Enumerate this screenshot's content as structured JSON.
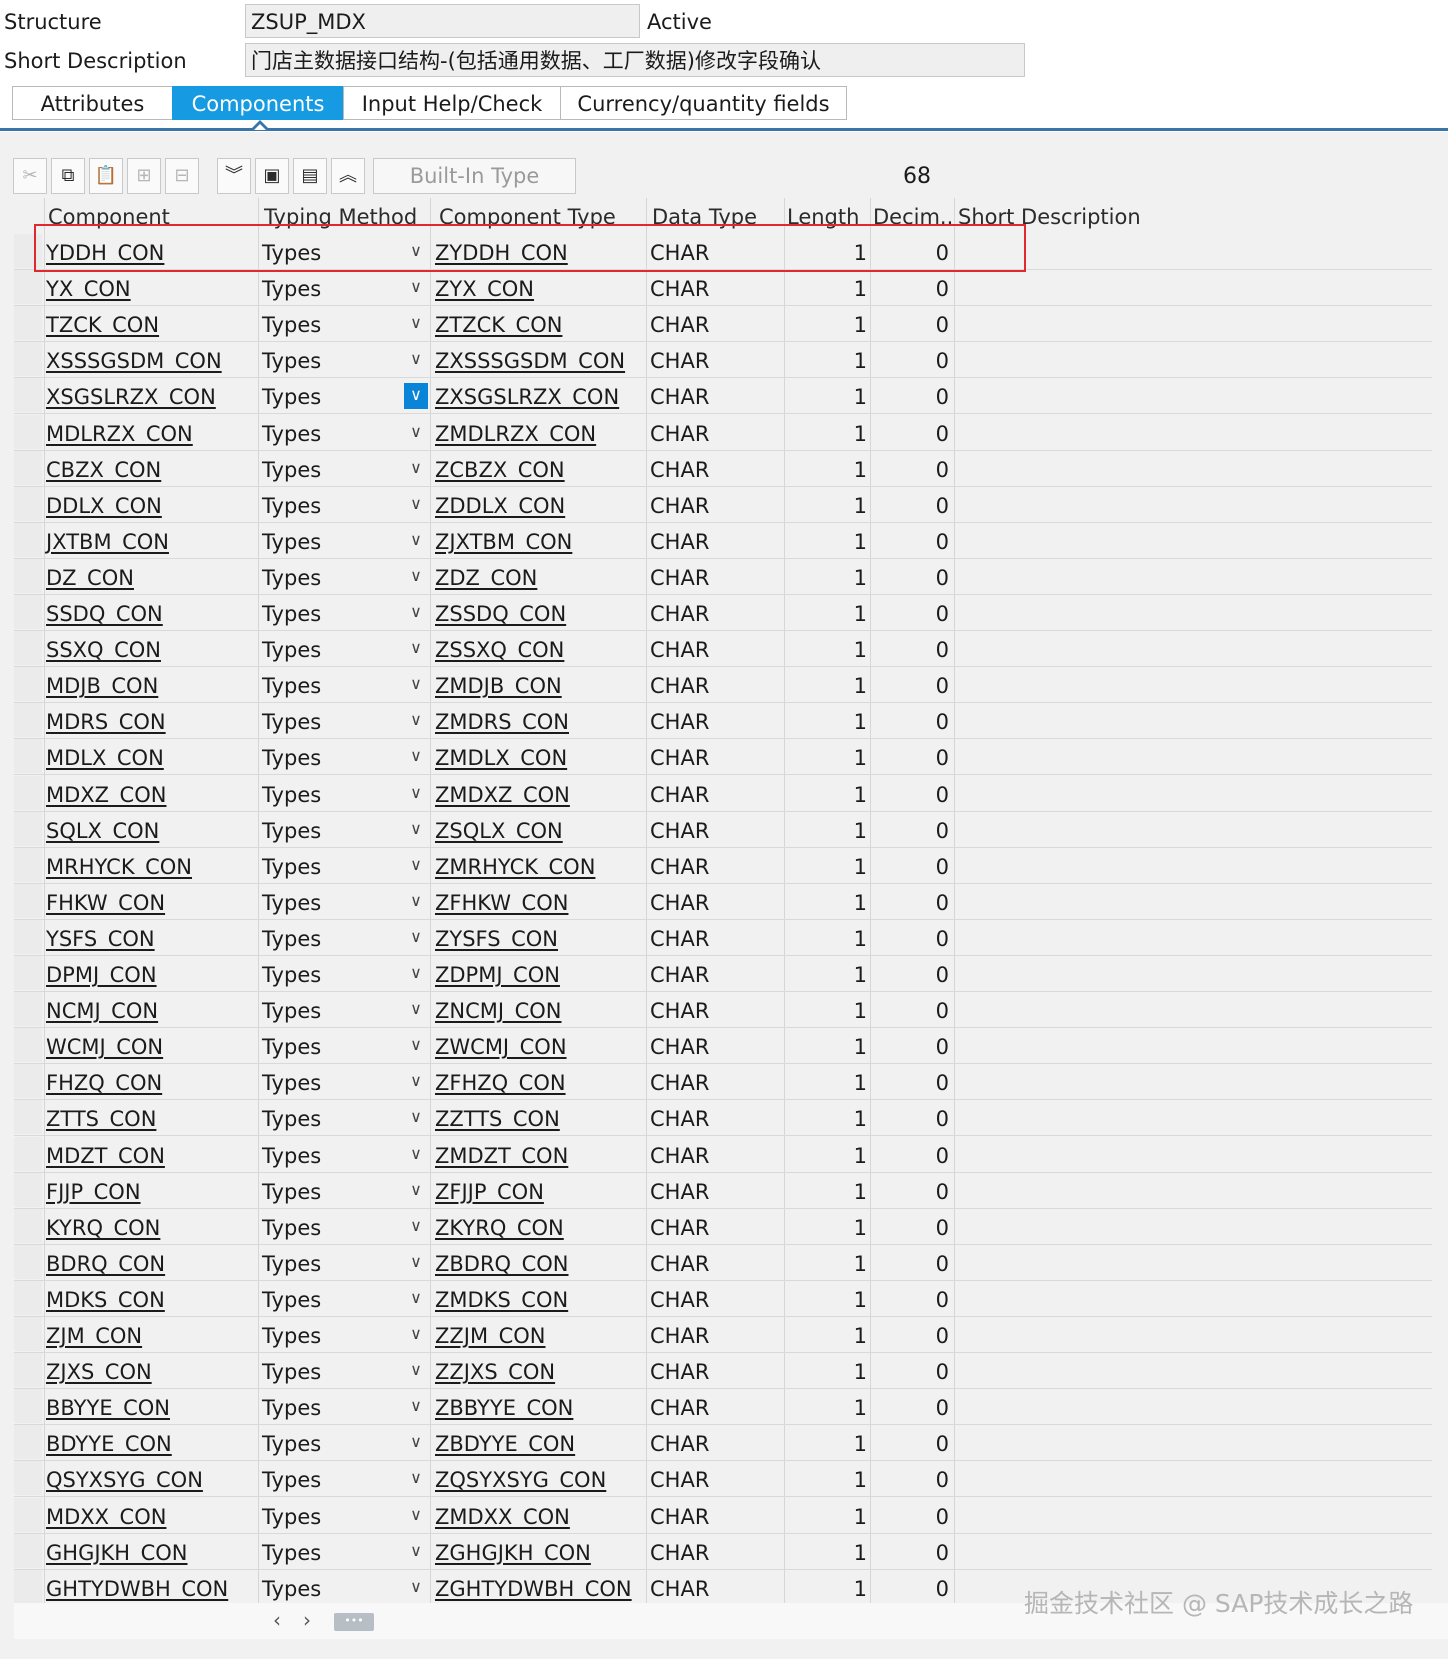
{
  "header": {
    "structure_label": "Structure",
    "structure_value": "ZSUP_MDX",
    "status": "Active",
    "short_desc_label": "Short Description",
    "short_desc_value": "门店主数据接口结构-(包括通用数据、工厂数据)修改字段确认"
  },
  "tabs": [
    {
      "label": "Attributes",
      "active": false
    },
    {
      "label": "Components",
      "active": true
    },
    {
      "label": "Input Help/Check",
      "active": false
    },
    {
      "label": "Currency/quantity fields",
      "active": false
    }
  ],
  "toolbar": {
    "icons": [
      "cut-icon",
      "copy-icon",
      "paste-icon",
      "insert-row-icon",
      "delete-row-icon",
      "expand-all-icon",
      "insert-field-icon",
      "include-icon",
      "collapse-all-icon"
    ],
    "builtin_label": "Built-In Type",
    "count": "68"
  },
  "columns": [
    "Component",
    "Typing Method",
    "Component Type",
    "Data Type",
    "Length",
    "Decim...",
    "Short Description"
  ],
  "rows": [
    {
      "component": "YDDH_CON",
      "typing": "Types",
      "ctype": "ZYDDH_CON",
      "dtype": "CHAR",
      "length": "1",
      "decimals": "0"
    },
    {
      "component": "YX_CON",
      "typing": "Types",
      "ctype": "ZYX_CON",
      "dtype": "CHAR",
      "length": "1",
      "decimals": "0"
    },
    {
      "component": "TZCK_CON",
      "typing": "Types",
      "ctype": "ZTZCK_CON",
      "dtype": "CHAR",
      "length": "1",
      "decimals": "0"
    },
    {
      "component": "XSSSGSDM_CON",
      "typing": "Types",
      "ctype": "ZXSSSGSDM_CON",
      "dtype": "CHAR",
      "length": "1",
      "decimals": "0"
    },
    {
      "component": "XSGSLRZX_CON",
      "typing": "Types",
      "ctype": "ZXSGSLRZX_CON",
      "dtype": "CHAR",
      "length": "1",
      "decimals": "0"
    },
    {
      "component": "MDLRZX_CON",
      "typing": "Types",
      "ctype": "ZMDLRZX_CON",
      "dtype": "CHAR",
      "length": "1",
      "decimals": "0"
    },
    {
      "component": "CBZX_CON",
      "typing": "Types",
      "ctype": "ZCBZX_CON",
      "dtype": "CHAR",
      "length": "1",
      "decimals": "0"
    },
    {
      "component": "DDLX_CON",
      "typing": "Types",
      "ctype": "ZDDLX_CON",
      "dtype": "CHAR",
      "length": "1",
      "decimals": "0"
    },
    {
      "component": "JXTBM_CON",
      "typing": "Types",
      "ctype": "ZJXTBM_CON",
      "dtype": "CHAR",
      "length": "1",
      "decimals": "0"
    },
    {
      "component": "DZ_CON",
      "typing": "Types",
      "ctype": "ZDZ_CON",
      "dtype": "CHAR",
      "length": "1",
      "decimals": "0"
    },
    {
      "component": "SSDQ_CON",
      "typing": "Types",
      "ctype": "ZSSDQ_CON",
      "dtype": "CHAR",
      "length": "1",
      "decimals": "0"
    },
    {
      "component": "SSXQ_CON",
      "typing": "Types",
      "ctype": "ZSSXQ_CON",
      "dtype": "CHAR",
      "length": "1",
      "decimals": "0"
    },
    {
      "component": "MDJB_CON",
      "typing": "Types",
      "ctype": "ZMDJB_CON",
      "dtype": "CHAR",
      "length": "1",
      "decimals": "0"
    },
    {
      "component": "MDRS_CON",
      "typing": "Types",
      "ctype": "ZMDRS_CON",
      "dtype": "CHAR",
      "length": "1",
      "decimals": "0"
    },
    {
      "component": "MDLX_CON",
      "typing": "Types",
      "ctype": "ZMDLX_CON",
      "dtype": "CHAR",
      "length": "1",
      "decimals": "0"
    },
    {
      "component": "MDXZ_CON",
      "typing": "Types",
      "ctype": "ZMDXZ_CON",
      "dtype": "CHAR",
      "length": "1",
      "decimals": "0"
    },
    {
      "component": "SQLX_CON",
      "typing": "Types",
      "ctype": "ZSQLX_CON",
      "dtype": "CHAR",
      "length": "1",
      "decimals": "0"
    },
    {
      "component": "MRHYCK_CON",
      "typing": "Types",
      "ctype": "ZMRHYCK_CON",
      "dtype": "CHAR",
      "length": "1",
      "decimals": "0"
    },
    {
      "component": "FHKW_CON",
      "typing": "Types",
      "ctype": "ZFHKW_CON",
      "dtype": "CHAR",
      "length": "1",
      "decimals": "0"
    },
    {
      "component": "YSFS_CON",
      "typing": "Types",
      "ctype": "ZYSFS_CON",
      "dtype": "CHAR",
      "length": "1",
      "decimals": "0"
    },
    {
      "component": "DPMJ_CON",
      "typing": "Types",
      "ctype": "ZDPMJ_CON",
      "dtype": "CHAR",
      "length": "1",
      "decimals": "0"
    },
    {
      "component": "NCMJ_CON",
      "typing": "Types",
      "ctype": "ZNCMJ_CON",
      "dtype": "CHAR",
      "length": "1",
      "decimals": "0"
    },
    {
      "component": "WCMJ_CON",
      "typing": "Types",
      "ctype": "ZWCMJ_CON",
      "dtype": "CHAR",
      "length": "1",
      "decimals": "0"
    },
    {
      "component": "FHZQ_CON",
      "typing": "Types",
      "ctype": "ZFHZQ_CON",
      "dtype": "CHAR",
      "length": "1",
      "decimals": "0"
    },
    {
      "component": "ZTTS_CON",
      "typing": "Types",
      "ctype": "ZZTTS_CON",
      "dtype": "CHAR",
      "length": "1",
      "decimals": "0"
    },
    {
      "component": "MDZT_CON",
      "typing": "Types",
      "ctype": "ZMDZT_CON",
      "dtype": "CHAR",
      "length": "1",
      "decimals": "0"
    },
    {
      "component": "FJJP_CON",
      "typing": "Types",
      "ctype": "ZFJJP_CON",
      "dtype": "CHAR",
      "length": "1",
      "decimals": "0"
    },
    {
      "component": "KYRQ_CON",
      "typing": "Types",
      "ctype": "ZKYRQ_CON",
      "dtype": "CHAR",
      "length": "1",
      "decimals": "0"
    },
    {
      "component": "BDRQ_CON",
      "typing": "Types",
      "ctype": "ZBDRQ_CON",
      "dtype": "CHAR",
      "length": "1",
      "decimals": "0"
    },
    {
      "component": "MDKS_CON",
      "typing": "Types",
      "ctype": "ZMDKS_CON",
      "dtype": "CHAR",
      "length": "1",
      "decimals": "0"
    },
    {
      "component": "ZJM_CON",
      "typing": "Types",
      "ctype": "ZZJM_CON",
      "dtype": "CHAR",
      "length": "1",
      "decimals": "0"
    },
    {
      "component": "ZJXS_CON",
      "typing": "Types",
      "ctype": "ZZJXS_CON",
      "dtype": "CHAR",
      "length": "1",
      "decimals": "0"
    },
    {
      "component": "BBYYE_CON",
      "typing": "Types",
      "ctype": "ZBBYYE_CON",
      "dtype": "CHAR",
      "length": "1",
      "decimals": "0"
    },
    {
      "component": "BDYYE_CON",
      "typing": "Types",
      "ctype": "ZBDYYE_CON",
      "dtype": "CHAR",
      "length": "1",
      "decimals": "0"
    },
    {
      "component": "QSYXSYG_CON",
      "typing": "Types",
      "ctype": "ZQSYXSYG_CON",
      "dtype": "CHAR",
      "length": "1",
      "decimals": "0"
    },
    {
      "component": "MDXX_CON",
      "typing": "Types",
      "ctype": "ZMDXX_CON",
      "dtype": "CHAR",
      "length": "1",
      "decimals": "0"
    },
    {
      "component": "GHGJKH_CON",
      "typing": "Types",
      "ctype": "ZGHGJKH_CON",
      "dtype": "CHAR",
      "length": "1",
      "decimals": "0"
    },
    {
      "component": "GHTYDWBH_CON",
      "typing": "Types",
      "ctype": "ZGHTYDWBH_CON",
      "dtype": "CHAR",
      "length": "1",
      "decimals": "0"
    }
  ],
  "focused_row_index": 4,
  "highlighted_row_index": 0,
  "colors": {
    "accent": "#169be2",
    "highlight": "#e0282e",
    "tabline": "#3a75a8"
  },
  "watermark": "掘金技术社区 @ SAP技术成长之路"
}
